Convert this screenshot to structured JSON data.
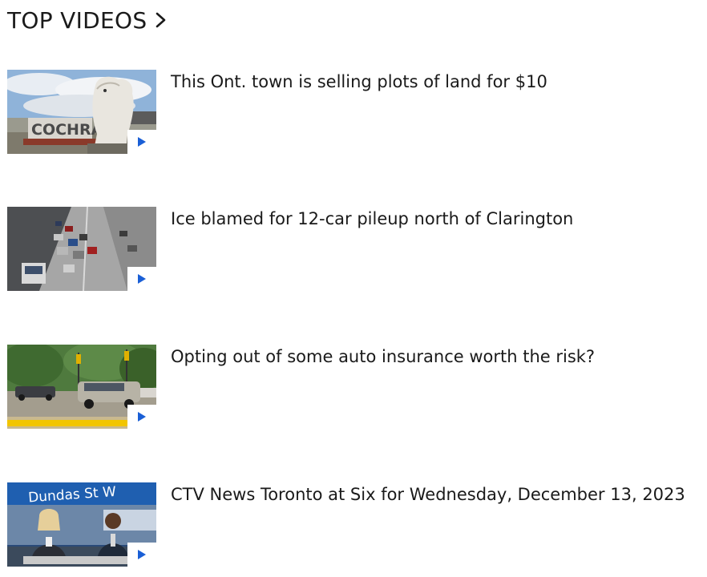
{
  "header": {
    "title": "TOP VIDEOS"
  },
  "videos": [
    {
      "title": "This Ont. town is selling plots of land for $10",
      "thumbnail_icon": "cochrane-polar-bear-sign"
    },
    {
      "title": "Ice blamed for 12-car pileup north of Clarington",
      "thumbnail_icon": "highway-pileup"
    },
    {
      "title": "Opting out of some auto insurance worth the risk?",
      "thumbnail_icon": "car-crash-scene"
    },
    {
      "title": "CTV News Toronto at Six for Wednesday, December 13, 2023",
      "thumbnail_icon": "news-anchors"
    }
  ],
  "colors": {
    "text": "#1a1a1a",
    "play_accent": "#1a5fd6",
    "badge_bg": "#ffffff"
  }
}
